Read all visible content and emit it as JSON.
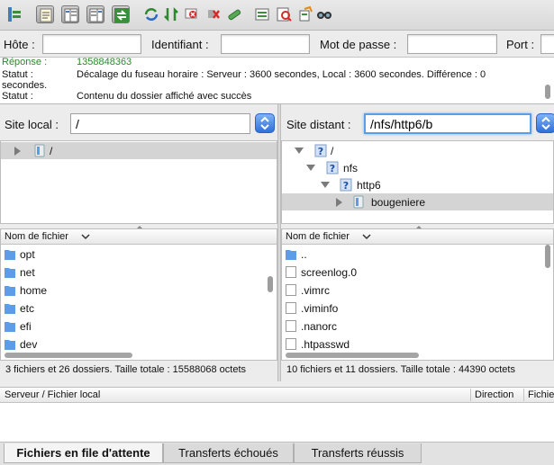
{
  "toolbar": {
    "icons": [
      "site-manager-icon",
      "message-log-icon",
      "local-tree-icon",
      "remote-tree-icon",
      "transfer-queue-icon",
      "refresh-icon",
      "process-queue-icon",
      "cancel-icon",
      "disconnect-icon",
      "reconnect-icon",
      "filter-icon",
      "compare-icon",
      "sync-browse-icon",
      "search-icon"
    ]
  },
  "quickconnect": {
    "host_label": "Hôte :",
    "user_label": "Identifiant :",
    "pass_label": "Mot de passe :",
    "port_label": "Port :",
    "host_value": "",
    "user_value": "",
    "pass_value": "",
    "port_value": ""
  },
  "log": {
    "partial_row": {
      "key": "Réponse :",
      "value": "1358848363"
    },
    "rows": [
      {
        "key": "Statut :",
        "value": "Décalage du fuseau horaire : Serveur : 3600 secondes, Local : 3600 secondes. Différence : 0",
        "cont": "secondes."
      },
      {
        "key": "Statut :",
        "value": "Contenu du dossier affiché avec succès"
      }
    ]
  },
  "local": {
    "label": "Site local :",
    "path": "/",
    "tree": [
      {
        "name": "/"
      }
    ],
    "column": "Nom de fichier",
    "files": [
      "opt",
      "net",
      "home",
      "etc",
      "efi",
      "dev"
    ],
    "status": "3 fichiers et 26 dossiers. Taille totale : 15588068 octets"
  },
  "remote": {
    "label": "Site distant :",
    "path": "/nfs/http6/b",
    "tree": [
      {
        "name": "/"
      },
      {
        "name": "nfs"
      },
      {
        "name": "http6"
      },
      {
        "name": "bougeniere"
      }
    ],
    "column": "Nom de fichier",
    "files": [
      "..",
      "screenlog.0",
      ".vimrc",
      ".viminfo",
      ".nanorc",
      ".htpasswd"
    ],
    "status": "10 fichiers et 11 dossiers. Taille totale : 44390 octets"
  },
  "queue": {
    "col_server": "Serveur / Fichier local",
    "col_direction": "Direction",
    "col_remote": "Fichie"
  },
  "tabs": {
    "queued": "Fichiers en file d'attente",
    "failed": "Transferts échoués",
    "success": "Transferts réussis"
  },
  "colors": {
    "folder": "#5d9ce6",
    "selection": "#d4d4d4",
    "focus": "#5b9ee8"
  }
}
